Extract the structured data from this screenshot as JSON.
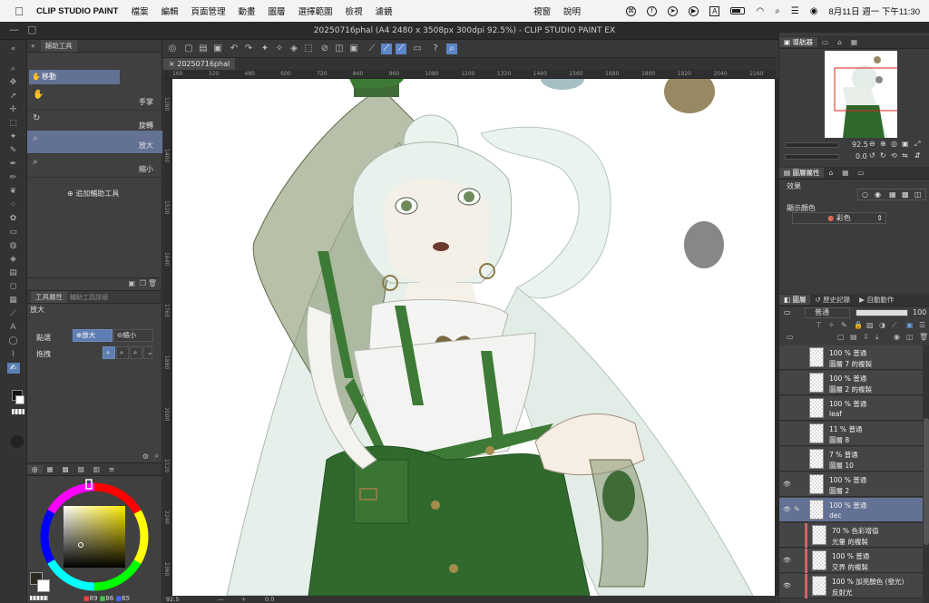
{
  "menubar": {
    "app": "CLIP STUDIO PAINT",
    "items": [
      "檔案",
      "編輯",
      "頁面管理",
      "動畫",
      "圖層",
      "選擇範圍",
      "檢視",
      "濾鏡"
    ],
    "right_items": [
      "視窗",
      "說明"
    ],
    "datetime": "8月11日 週一 下午11:30"
  },
  "window": {
    "title": "20250716phal (A4 2480 x 3508px 300dpi 92.5%) - CLIP STUDIO PAINT EX"
  },
  "subtool": {
    "tab_label": "輔助工具",
    "group_label": "移動",
    "items": [
      {
        "label": "手掌",
        "icon": "hand-icon"
      },
      {
        "label": "旋轉",
        "icon": "rotate-icon"
      },
      {
        "label": "放大",
        "icon": "zoom-in-icon"
      },
      {
        "label": "縮小",
        "icon": "zoom-out-icon"
      }
    ],
    "add_label": "追加輔助工具"
  },
  "tool_property": {
    "tab_label": "工具屬性",
    "tab2_label": "輔助工具詳細",
    "title": "放大",
    "click_label": "點選",
    "click_zoom_in": "放大",
    "click_zoom_out": "縮小",
    "drag_label": "拖拽"
  },
  "color": {
    "r_value": "89",
    "g_value": "86",
    "b_value": "65",
    "main_color": "#2c2a1f",
    "sub_color": "#ffffff",
    "accent": "#5f7db0"
  },
  "doc_tab": {
    "label": "20250716phal"
  },
  "ruler": {
    "top": [
      "160",
      "320",
      "480",
      "600",
      "720",
      "840",
      "960",
      "1080",
      "1200",
      "1320",
      "1440",
      "1560",
      "1680",
      "1800",
      "1920",
      "2040",
      "2160"
    ],
    "left": [
      "1280",
      "1400",
      "1520",
      "1640",
      "1760",
      "1880",
      "2000",
      "2120",
      "2240",
      "2360"
    ]
  },
  "status": {
    "zoom": "92.5",
    "angle": "0.0"
  },
  "navigator": {
    "tab_label": "導航器",
    "zoom_value": "92.5",
    "angle_value": "0.0"
  },
  "layer_property": {
    "tab_label": "圖層屬性",
    "effect_label": "效果",
    "display_color_label": "顯示顏色",
    "color_value": "彩色"
  },
  "layer_panel": {
    "tab_label": "圖層",
    "tab2_label": "歷史記錄",
    "tab3_label": "自動動作",
    "blend_mode": "普通",
    "opacity": "100",
    "layers": [
      {
        "mode": "100 % 普通",
        "name": "圖層 7 的複製",
        "visible": false,
        "selected": false,
        "clipped": false
      },
      {
        "mode": "100 % 普通",
        "name": "圖層 2 的複製",
        "visible": false,
        "selected": false,
        "clipped": false
      },
      {
        "mode": "100 % 普通",
        "name": "leaf",
        "visible": false,
        "selected": false,
        "clipped": false
      },
      {
        "mode": "11 % 普通",
        "name": "圖層 8",
        "visible": false,
        "selected": false,
        "clipped": false
      },
      {
        "mode": "7 % 普通",
        "name": "圖層 10",
        "visible": false,
        "selected": false,
        "clipped": false
      },
      {
        "mode": "100 % 普通",
        "name": "圖層 2",
        "visible": true,
        "selected": false,
        "clipped": false
      },
      {
        "mode": "100 % 普通",
        "name": "dec",
        "visible": true,
        "selected": true,
        "clipped": false
      },
      {
        "mode": "70 % 色彩增值",
        "name": "光暈 的複製",
        "visible": false,
        "selected": false,
        "clipped": true
      },
      {
        "mode": "100 % 普通",
        "name": "交界 的複製",
        "visible": true,
        "selected": false,
        "clipped": true
      },
      {
        "mode": "100 % 加亮顏色 (發光)",
        "name": "反射光",
        "visible": true,
        "selected": false,
        "clipped": true
      }
    ]
  }
}
